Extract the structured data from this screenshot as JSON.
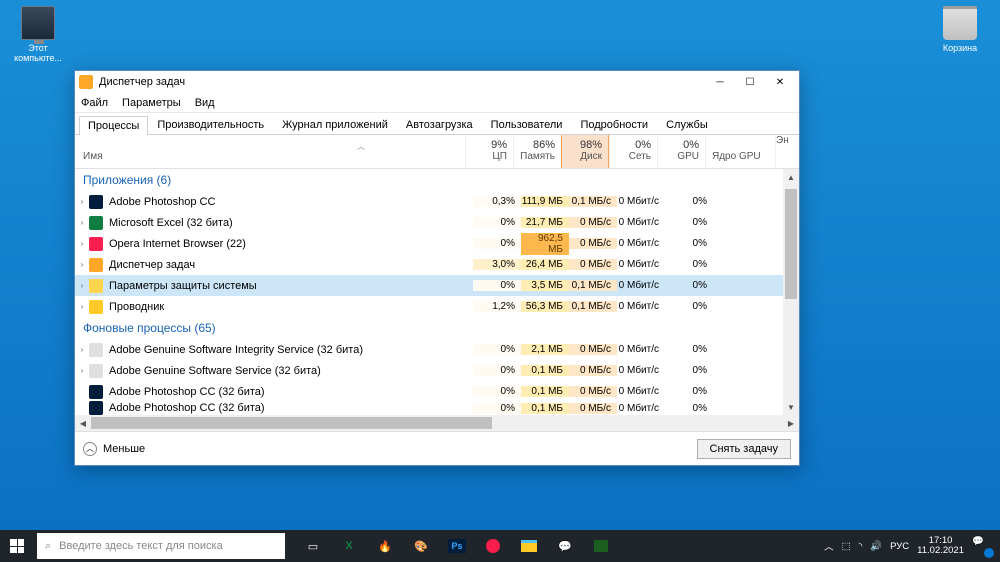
{
  "desktop": {
    "icons": {
      "computer": "Этот\nкомпьюте...",
      "recycle": "Корзина"
    }
  },
  "window": {
    "title": "Диспетчер задач",
    "menu": [
      "Файл",
      "Параметры",
      "Вид"
    ],
    "tabs": [
      "Процессы",
      "Производительность",
      "Журнал приложений",
      "Автозагрузка",
      "Пользователи",
      "Подробности",
      "Службы"
    ],
    "active_tab": 0,
    "columns": {
      "name": "Имя",
      "metrics": [
        {
          "pct": "9%",
          "label": "ЦП"
        },
        {
          "pct": "86%",
          "label": "Память"
        },
        {
          "pct": "98%",
          "label": "Диск",
          "hot": true
        },
        {
          "pct": "0%",
          "label": "Сеть"
        },
        {
          "pct": "0%",
          "label": "GPU"
        }
      ],
      "gpu_core": "Ядро GPU",
      "end": "Эн"
    },
    "groups": [
      {
        "title": "Приложения (6)",
        "rows": [
          {
            "icon": "#001d3d",
            "name": "Adobe Photoshop CC",
            "cpu": "0,3%",
            "mem": "111,9 МБ",
            "disk": "0,1 МБ/с",
            "net": "0 Мбит/с",
            "gpu": "0%"
          },
          {
            "icon": "#107c41",
            "name": "Microsoft Excel (32 бита)",
            "cpu": "0%",
            "mem": "21,7 МБ",
            "disk": "0 МБ/с",
            "net": "0 Мбит/с",
            "gpu": "0%"
          },
          {
            "icon": "#fa1e4e",
            "name": "Opera Internet Browser (22)",
            "cpu": "0%",
            "mem": "962,5 МБ",
            "mem_hot": true,
            "disk": "0 МБ/с",
            "net": "0 Мбит/с",
            "gpu": "0%"
          },
          {
            "icon": "#ffa726",
            "name": "Диспетчер задач",
            "cpu": "3,0%",
            "cpu_hot": true,
            "mem": "26,4 МБ",
            "disk": "0 МБ/с",
            "net": "0 Мбит/с",
            "gpu": "0%"
          },
          {
            "icon": "#ffd54f",
            "name": "Параметры защиты системы",
            "cpu": "0%",
            "mem": "3,5 МБ",
            "disk": "0,1 МБ/с",
            "net": "0 Мбит/с",
            "gpu": "0%",
            "selected": true
          },
          {
            "icon": "#ffca28",
            "name": "Проводник",
            "cpu": "1,2%",
            "mem": "56,3 МБ",
            "disk": "0,1 МБ/с",
            "net": "0 Мбит/с",
            "gpu": "0%"
          }
        ]
      },
      {
        "title": "Фоновые процессы (65)",
        "rows": [
          {
            "icon": "#e0e0e0",
            "name": "Adobe Genuine Software Integrity Service (32 бита)",
            "cpu": "0%",
            "mem": "2,1 МБ",
            "disk": "0 МБ/с",
            "net": "0 Мбит/с",
            "gpu": "0%"
          },
          {
            "icon": "#e0e0e0",
            "name": "Adobe Genuine Software Service (32 бита)",
            "cpu": "0%",
            "mem": "0,1 МБ",
            "disk": "0 МБ/с",
            "net": "0 Мбит/с",
            "gpu": "0%"
          },
          {
            "icon": "#001d3d",
            "name": "Adobe Photoshop CC (32 бита)",
            "no_chev": true,
            "cpu": "0%",
            "mem": "0,1 МБ",
            "disk": "0 МБ/с",
            "net": "0 Мбит/с",
            "gpu": "0%"
          },
          {
            "icon": "#001d3d",
            "name": "Adobe Photoshop CC (32 бита)",
            "no_chev": true,
            "cpu": "0%",
            "mem": "0,1 МБ",
            "disk": "0 МБ/с",
            "net": "0 Мбит/с",
            "gpu": "0%",
            "partial": true
          }
        ]
      }
    ],
    "footer": {
      "less": "Меньше",
      "end_task": "Снять задачу"
    }
  },
  "taskbar": {
    "search_placeholder": "Введите здесь текст для поиска",
    "lang": "РУС",
    "time": "17:10",
    "date": "11.02.2021",
    "notif_count": "4"
  }
}
